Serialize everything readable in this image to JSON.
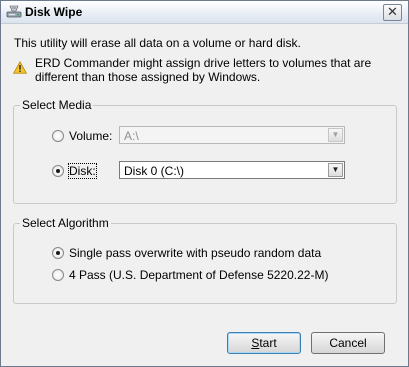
{
  "window": {
    "title": "Disk Wipe",
    "close_glyph": "✕"
  },
  "intro": "This utility will erase all data on a volume or hard disk.",
  "warning": {
    "icon": "warning-icon",
    "line1": "ERD Commander might assign drive letters to volumes that are",
    "line2": "different than those assigned by Windows."
  },
  "select_media": {
    "legend": "Select Media",
    "volume": {
      "label": "Volume:",
      "checked": false,
      "value": "A:\\",
      "enabled": false
    },
    "disk": {
      "label": "Disk:",
      "checked": true,
      "value": "Disk 0 (C:\\)",
      "enabled": true
    }
  },
  "select_algorithm": {
    "legend": "Select Algorithm",
    "options": [
      {
        "label": "Single pass overwrite with pseudo random data",
        "checked": true
      },
      {
        "label": "4 Pass (U.S. Department of Defense 5220.22-M)",
        "checked": false
      }
    ]
  },
  "buttons": {
    "start": {
      "label_first": "S",
      "label_rest": "tart"
    },
    "cancel": "Cancel"
  }
}
